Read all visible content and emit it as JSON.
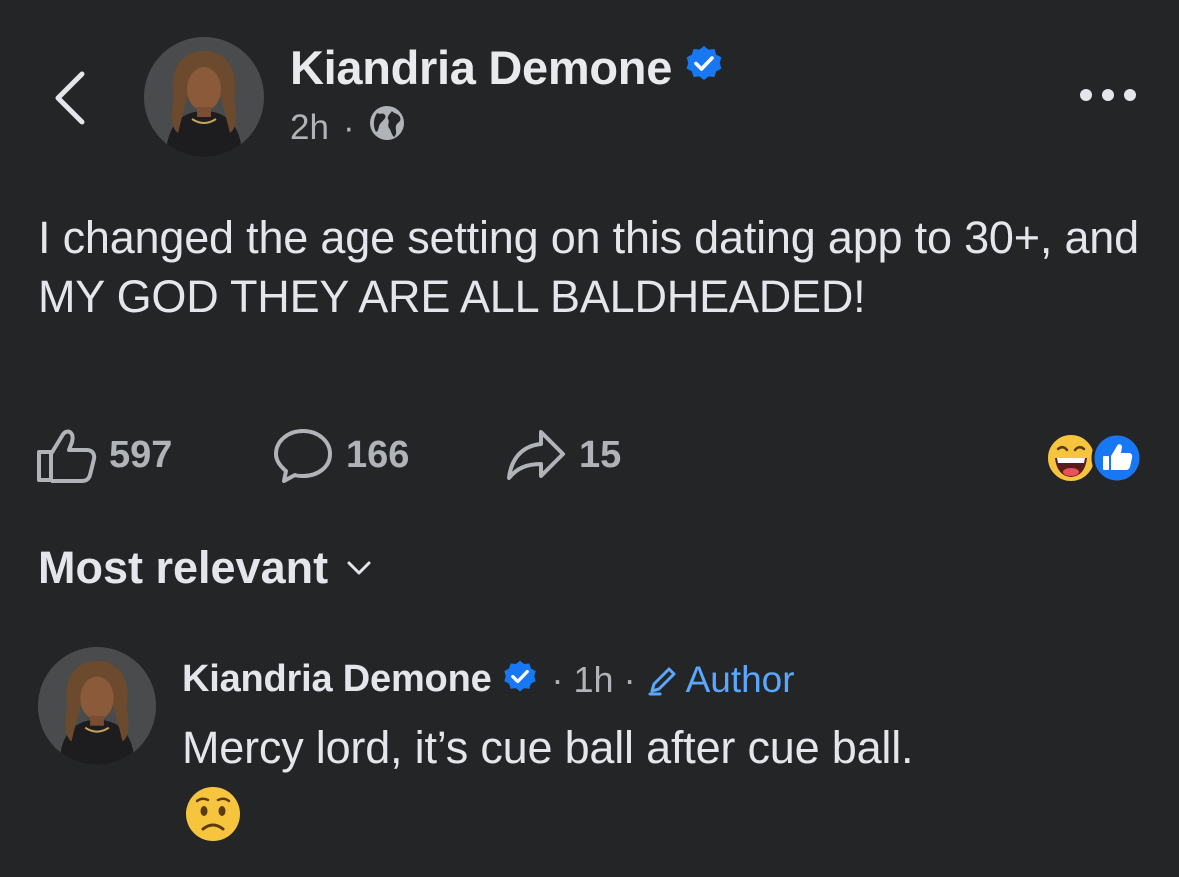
{
  "post": {
    "author_name": "Kiandria Demone",
    "verified": true,
    "time": "2h",
    "meta_separator": "·",
    "audience_icon": "globe-icon",
    "text": "I changed the age setting on this dating app to 30+, and MY GOD THEY ARE ALL BALDHEADED!",
    "likes": "597",
    "comments": "166",
    "shares": "15",
    "reactions": [
      "laughing-reaction",
      "like-reaction"
    ]
  },
  "comments_section": {
    "sort_label": "Most relevant"
  },
  "comment": {
    "author_name": "Kiandria Demone",
    "verified": true,
    "time": "· 1h ·",
    "badge": "Author",
    "text": "Mercy lord, it’s cue ball after cue ball.",
    "emoji": "worried-face"
  },
  "colors": {
    "background": "#242526",
    "primary_text": "#e4e6eb",
    "secondary_text": "#b0b3b8",
    "verified_blue": "#1877f2",
    "author_blue": "#5aa7ff"
  }
}
